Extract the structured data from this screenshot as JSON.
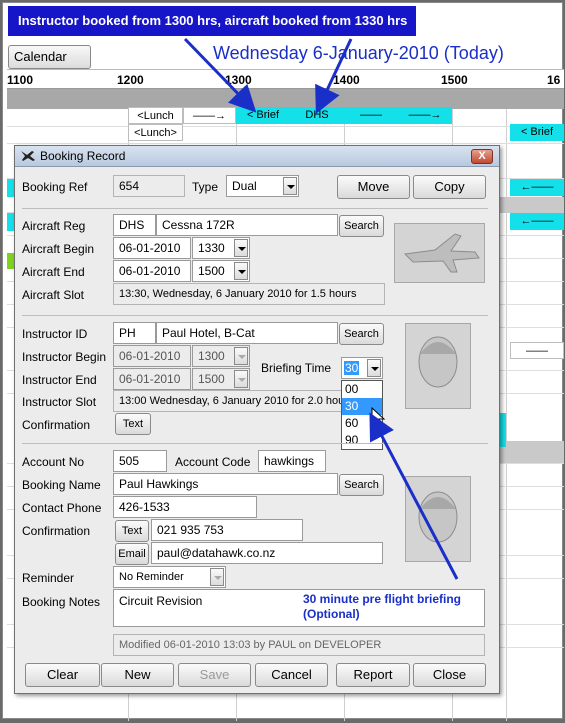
{
  "callout": {
    "text": "Instructor booked from 1300 hrs, aircraft booked from 1330 hrs"
  },
  "schedule": {
    "calendar_button": "Calendar",
    "date_title": "Wednesday 6-January-2010  (Today)",
    "hours": [
      "1100",
      "1200",
      "1300",
      "1400",
      "1500",
      "16"
    ],
    "row1": [
      "<Lunch",
      "——→",
      "< Brief",
      "DHS",
      "——",
      "——→"
    ],
    "row2_lunch": "<Lunch>",
    "right_brief": "< Brief",
    "right_arrow1": "←——",
    "right_arrow2": "←——",
    "right_dash": "——"
  },
  "dialog": {
    "title": "Booking Record",
    "close": "X",
    "booking_ref_label": "Booking Ref",
    "booking_ref": "654",
    "type_label": "Type",
    "type_value": "Dual",
    "move_button": "Move",
    "copy_button": "Copy",
    "aircraft_reg_label": "Aircraft Reg",
    "aircraft_reg": "DHS",
    "aircraft_name": "Cessna 172R",
    "search_label": "Search",
    "aircraft_begin_label": "Aircraft Begin",
    "aircraft_begin_date": "06-01-2010",
    "aircraft_begin_time": "1330",
    "aircraft_end_label": "Aircraft End",
    "aircraft_end_date": "06-01-2010",
    "aircraft_end_time": "1500",
    "aircraft_slot_label": "Aircraft Slot",
    "aircraft_slot": "13:30, Wednesday, 6 January 2010 for 1.5 hours",
    "instructor_id_label": "Instructor ID",
    "instructor_id": "PH",
    "instructor_name": "Paul Hotel, B-Cat",
    "instructor_begin_label": "Instructor Begin",
    "instructor_begin_date": "06-01-2010",
    "instructor_begin_time": "1300",
    "instructor_end_label": "Instructor End",
    "instructor_end_date": "06-01-2010",
    "instructor_end_time": "1500",
    "briefing_time_label": "Briefing Time",
    "briefing_time_value": "30",
    "briefing_options": [
      "00",
      "30",
      "60",
      "90"
    ],
    "instructor_slot_label": "Instructor Slot",
    "instructor_slot": "13:00 Wednesday, 6 January 2010 for 2.0 hou",
    "confirmation_label": "Confirmation",
    "text_button": "Text",
    "account_no_label": "Account No",
    "account_no": "505",
    "account_code_label": "Account Code",
    "account_code": "hawkings",
    "booking_name_label": "Booking Name",
    "booking_name": "Paul Hawkings",
    "contact_phone_label": "Contact Phone",
    "contact_phone": "426-1533",
    "confirmation2_label": "Confirmation",
    "sms_number": "021 935 753",
    "email_button": "Email",
    "email": "paul@datahawk.co.nz",
    "reminder_label": "Reminder",
    "reminder_value": "No Reminder",
    "booking_notes_label": "Booking Notes",
    "booking_notes": "Circuit Revision",
    "note_line1": "30 minute pre flight briefing",
    "note_line2": "(Optional)",
    "modified": "Modified 06-01-2010 13:03 by PAUL on DEVELOPER",
    "buttons": {
      "clear": "Clear",
      "new": "New",
      "save": "Save",
      "cancel": "Cancel",
      "report": "Report",
      "close": "Close"
    }
  }
}
